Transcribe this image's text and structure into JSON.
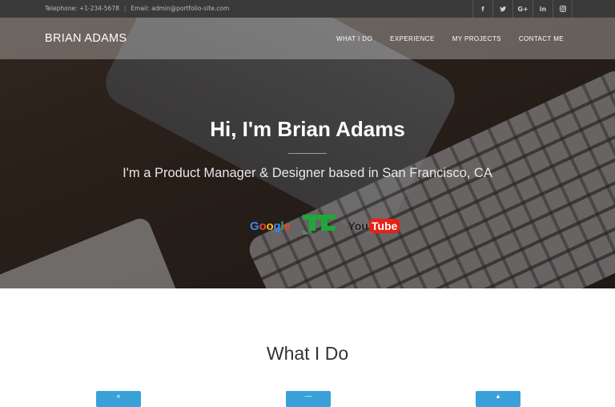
{
  "topbar": {
    "phone": "Telephone: +1-234-5678",
    "separator": "|",
    "email": "Email: admin@portfolio-site.com",
    "social": [
      {
        "icon": "facebook-icon",
        "glyph": "f"
      },
      {
        "icon": "twitter-icon",
        "glyph": "t"
      },
      {
        "icon": "google-plus-icon",
        "glyph": "G+"
      },
      {
        "icon": "linkedin-icon",
        "glyph": "in"
      },
      {
        "icon": "instagram-icon",
        "glyph": ""
      }
    ]
  },
  "nav": {
    "brand": "BRIAN ADAMS",
    "items": [
      "WHAT I DO",
      "EXPERIENCE",
      "MY PROJECTS",
      "CONTACT ME"
    ]
  },
  "hero": {
    "title": "Hi, I'm Brian Adams",
    "subtitle": "I'm a Product Manager & Designer based in San Francisco, CA",
    "logos": {
      "google": [
        "G",
        "o",
        "o",
        "g",
        "l",
        "e"
      ],
      "techcrunch_caption": "Tech",
      "youtube_you": "You",
      "youtube_tube": "Tube"
    }
  },
  "section": {
    "title": "What I Do"
  },
  "colors": {
    "topbar_bg": "#3a3a3a",
    "accent": "#3aa0d8",
    "heading": "#333333"
  }
}
